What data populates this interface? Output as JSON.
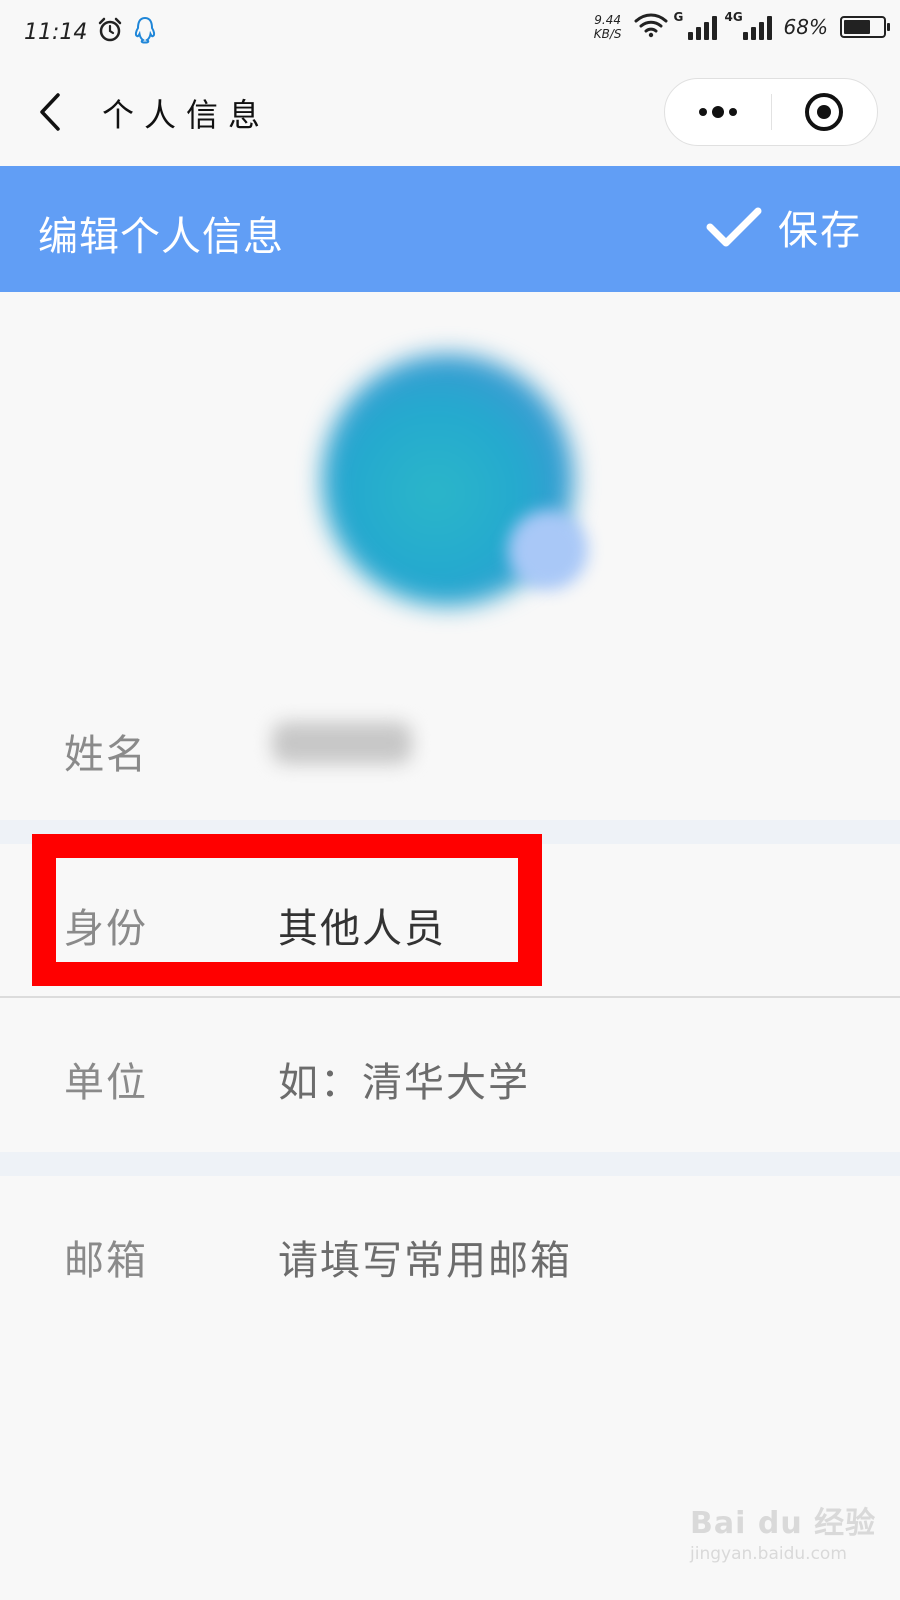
{
  "status_bar": {
    "time": "11:14",
    "net_speed_value": "9.44",
    "net_speed_unit": "KB/S",
    "sim1_tag": "G",
    "sim2_tag": "4G",
    "battery_percent": "68%",
    "battery_level": 0.68
  },
  "nav": {
    "title": "个人信息",
    "icons": {
      "back": "chevron-left-icon",
      "more": "more-dots-icon",
      "close": "target-close-icon"
    }
  },
  "header": {
    "title": "编辑个人信息",
    "save_label": "保存",
    "background": "#619ef5"
  },
  "form": {
    "name": {
      "label": "姓名",
      "value": ""
    },
    "identity": {
      "label": "身份",
      "value": "其他人员"
    },
    "unit": {
      "label": "单位",
      "placeholder": "如：清华大学"
    },
    "email": {
      "label": "邮箱",
      "placeholder": "请填写常用邮箱"
    }
  },
  "annotation": {
    "highlight_color": "#ff0000"
  },
  "watermark": {
    "main": "Bai du 经验",
    "sub": "jingyan.baidu.com"
  }
}
